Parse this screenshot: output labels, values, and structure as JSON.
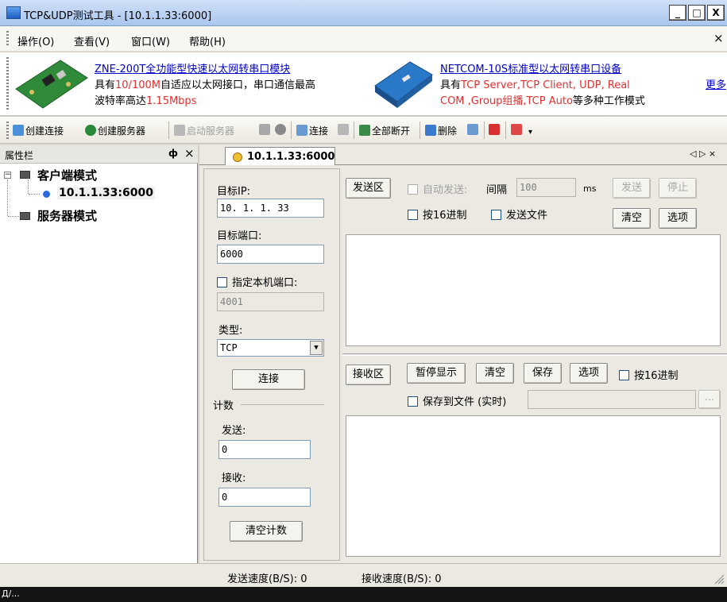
{
  "window": {
    "title": "TCP&UDP测试工具 - [10.1.1.33:6000]",
    "controls": {
      "minimize": "_",
      "maximize": "□",
      "close": "X"
    }
  },
  "menu": {
    "items": [
      "操作(O)",
      "查看(V)",
      "窗口(W)",
      "帮助(H)"
    ],
    "close": "×"
  },
  "ad": {
    "left_title": "ZNE-200T全功能型快速以太网转串口模块",
    "left_line2_a": "具有",
    "left_line2_b": "10/100M",
    "left_line2_c": "自适应以太网接口，串口通信最高",
    "left_line3_a": "波特率高达",
    "left_line3_b": "1.15Mbps",
    "right_title": "NETCOM-10S标准型以太网转串口设备",
    "right_line2_a": "具有",
    "right_line2_b": "TCP Server,TCP Client, UDP, Real",
    "right_line3_a": "COM ,Group组播,TCP Auto",
    "right_line3_b": "等多种工作模式",
    "more": "更多"
  },
  "toolbar": {
    "create_connection": "创建连接",
    "create_server": "创建服务器",
    "start_server": "启动服务器",
    "connect": "连接",
    "disconnect_all": "全部断开",
    "delete": "删除"
  },
  "left_panel": {
    "title": "属性栏",
    "pin": "ф",
    "close": "×",
    "client_mode": "客户端模式",
    "client_entry": "10.1.1.33:6000",
    "server_mode": "服务器模式"
  },
  "tab": {
    "label": "10.1.1.33:6000",
    "nav": "◁ ▷ ×"
  },
  "settings": {
    "target_ip_label": "目标IP:",
    "target_ip": "10. 1. 1. 33",
    "target_port_label": "目标端口:",
    "target_port": "6000",
    "local_port_label": "指定本机端口:",
    "local_port": "4001",
    "type_label": "类型:",
    "type_value": "TCP",
    "connect_button": "连接",
    "count_label": "计数",
    "send_label": "发送:",
    "send_count": "0",
    "recv_label": "接收:",
    "recv_count": "0",
    "clear_count_button": "清空计数"
  },
  "send_area": {
    "title": "发送区",
    "auto_send": "自动发送:",
    "interval_label": "间隔",
    "interval_value": "100",
    "interval_unit": "ms",
    "send_button": "发送",
    "stop_button": "停止",
    "hex": "按16进制",
    "send_file": "发送文件",
    "clear_button": "清空",
    "options_button": "选项"
  },
  "recv_area": {
    "title": "接收区",
    "pause_button": "暂停显示",
    "clear_button": "清空",
    "save_button": "保存",
    "options_button": "选项",
    "hex": "按16进制",
    "save_to_file": "保存到文件 (实时)",
    "browse": "..."
  },
  "status": {
    "send_speed_label": "发送速度(B/S):",
    "send_speed": "0",
    "recv_speed_label": "接收速度(B/S):",
    "recv_speed": "0"
  },
  "taskbar": {
    "text": "Д/..."
  }
}
